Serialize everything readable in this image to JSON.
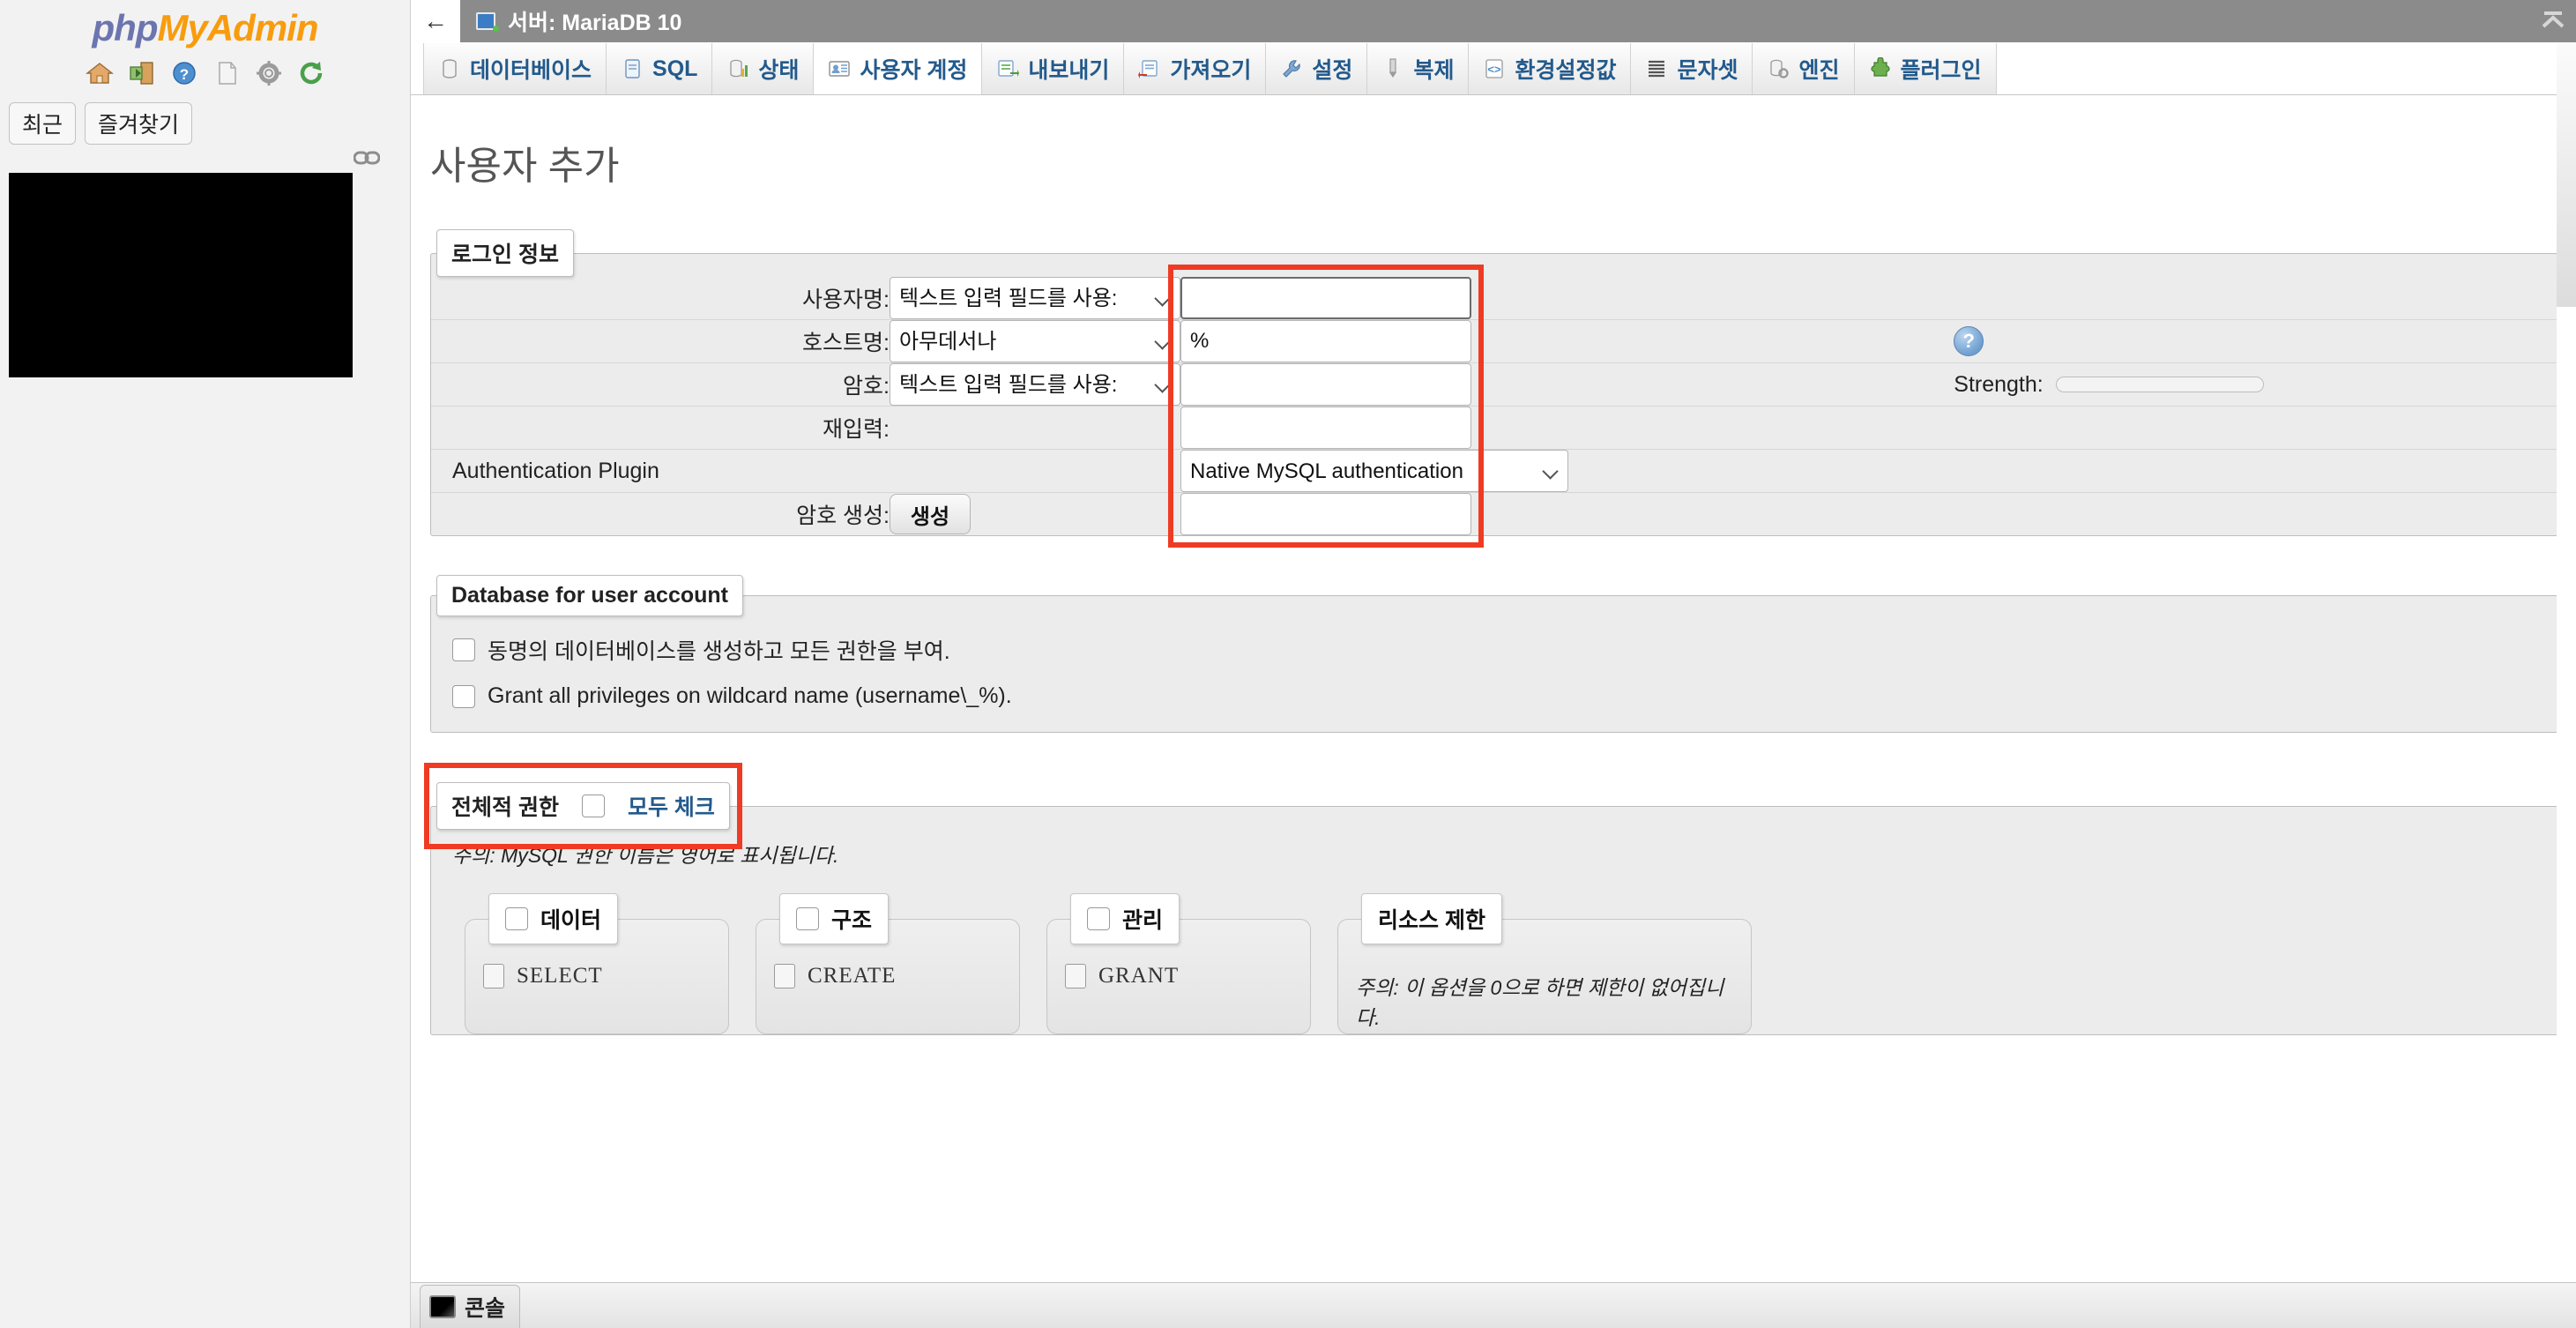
{
  "sidebar": {
    "logo_php": "php",
    "logo_myadmin": "MyAdmin",
    "icons": [
      "home-icon",
      "logout-icon",
      "help-icon",
      "docs-icon",
      "settings-icon",
      "reload-icon"
    ],
    "pills": [
      {
        "label": "최근",
        "name": "recent-button"
      },
      {
        "label": "즐겨찾기",
        "name": "favorites-button"
      }
    ],
    "chain_icon": "chain-link-icon"
  },
  "serverbar": {
    "back_label": "←",
    "title": "서버: MariaDB 10",
    "scroll_up_label": "⌃"
  },
  "tabs": [
    {
      "label": "데이터베이스",
      "icon": "database-icon",
      "active": false
    },
    {
      "label": "SQL",
      "icon": "sql-icon",
      "active": false
    },
    {
      "label": "상태",
      "icon": "status-icon",
      "active": false
    },
    {
      "label": "사용자 계정",
      "icon": "user-accounts-icon",
      "active": true
    },
    {
      "label": "내보내기",
      "icon": "export-icon",
      "active": false
    },
    {
      "label": "가져오기",
      "icon": "import-icon",
      "active": false
    },
    {
      "label": "설정",
      "icon": "settings-wrench-icon",
      "active": false
    },
    {
      "label": "복제",
      "icon": "replication-icon",
      "active": false
    },
    {
      "label": "환경설정값",
      "icon": "variables-icon",
      "active": false
    },
    {
      "label": "문자셋",
      "icon": "charsets-icon",
      "active": false
    },
    {
      "label": "엔진",
      "icon": "engines-icon",
      "active": false
    },
    {
      "label": "플러그인",
      "icon": "plugins-icon",
      "active": false
    }
  ],
  "page": {
    "title": "사용자 추가"
  },
  "login_info": {
    "legend": "로그인 정보",
    "username": {
      "label": "사용자명:",
      "select_value": "텍스트 입력 필드를 사용:",
      "input_value": "",
      "focused": true
    },
    "hostname": {
      "label": "호스트명:",
      "select_value": "아무데서나",
      "input_value": "%",
      "help_icon": "help-circle-icon"
    },
    "password": {
      "label": "암호:",
      "select_value": "텍스트 입력 필드를 사용:",
      "input_value": "",
      "strength_label": "Strength:",
      "strength_value": ""
    },
    "retype": {
      "label": "재입력:",
      "input_value": ""
    },
    "auth_plugin": {
      "label": "Authentication Plugin",
      "select_value": "Native MySQL authentication"
    },
    "generate_password": {
      "label": "암호 생성:",
      "button_label": "생성",
      "input_value": ""
    }
  },
  "database_for_user": {
    "legend": "Database for user account",
    "checkboxes": [
      {
        "label": "동명의 데이터베이스를 생성하고 모든 권한을 부여.",
        "checked": false
      },
      {
        "label": "Grant all privileges on wildcard name (username\\_%).",
        "checked": false
      }
    ]
  },
  "global_privileges": {
    "legend": "전체적 권한",
    "check_all_label": "모두 체크",
    "check_all_checked": false,
    "note": "주의: MySQL 권한 이름은 영어로 표시됩니다."
  },
  "privilege_panels": [
    {
      "legend": "데이터",
      "checked": false,
      "first_item": "SELECT",
      "item_checked": false
    },
    {
      "legend": "구조",
      "checked": false,
      "first_item": "CREATE",
      "item_checked": false
    },
    {
      "legend": "관리",
      "checked": false,
      "first_item": "GRANT",
      "item_checked": false
    }
  ],
  "resource_limits": {
    "legend": "리소스 제한",
    "note": "주의: 이 옵션을 0으로 하면 제한이 없어집니다."
  },
  "console": {
    "label": "콘솔",
    "icon": "terminal-icon"
  },
  "colors": {
    "annotation": "#ef3b23",
    "tab_text": "#235a8c",
    "server_bar": "#8b8b8b",
    "panel_bg": "#ececec",
    "logo_php": "#6c75af",
    "logo_myadmin": "#f89c0e"
  }
}
